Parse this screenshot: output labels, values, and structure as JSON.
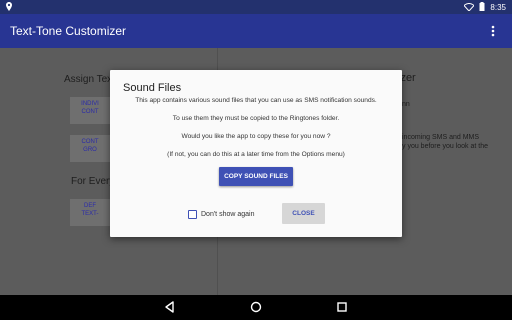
{
  "status_bar": {
    "time": "8:35",
    "icons": [
      "location-icon",
      "wifi-icon",
      "battery-icon"
    ]
  },
  "app_bar": {
    "title": "Text-Tone Customizer",
    "menu_icon": "more-vert-icon"
  },
  "background": {
    "left": {
      "assign_heading": "Assign Tex",
      "individual_button": [
        "INDIVI",
        "CONT"
      ],
      "contacts_group_button": [
        "CONT",
        "GRO"
      ],
      "for_every_heading": "For Every",
      "default_button": [
        "DEF",
        "TEXT-"
      ]
    },
    "right": {
      "title_fragment": "izer",
      "line_1": "nn",
      "line_2": "incoming SMS and MMS",
      "line_3": "y you before you look at the"
    }
  },
  "dialog": {
    "title": "Sound Files",
    "line_1": "This app contains various sound files that you can use as SMS notification sounds.",
    "line_2": "To use them they must be copied to the Ringtones folder.",
    "line_3": "Would you like the app to copy these for you now ?",
    "line_4": "(If not, you can do this at a later time from the Options menu)",
    "copy_button": "COPY SOUND FILES",
    "checkbox_label": "Don't show again",
    "checkbox_checked": false,
    "close_button": "CLOSE"
  },
  "nav_bar": {
    "icons": [
      "back-icon",
      "home-icon",
      "recents-icon"
    ]
  },
  "colors": {
    "status_bar": "#23316e",
    "app_bar": "#283593",
    "accent": "#3f51b5",
    "scrim_background": "#5c5c5c",
    "dialog_background": "#fafafa"
  }
}
